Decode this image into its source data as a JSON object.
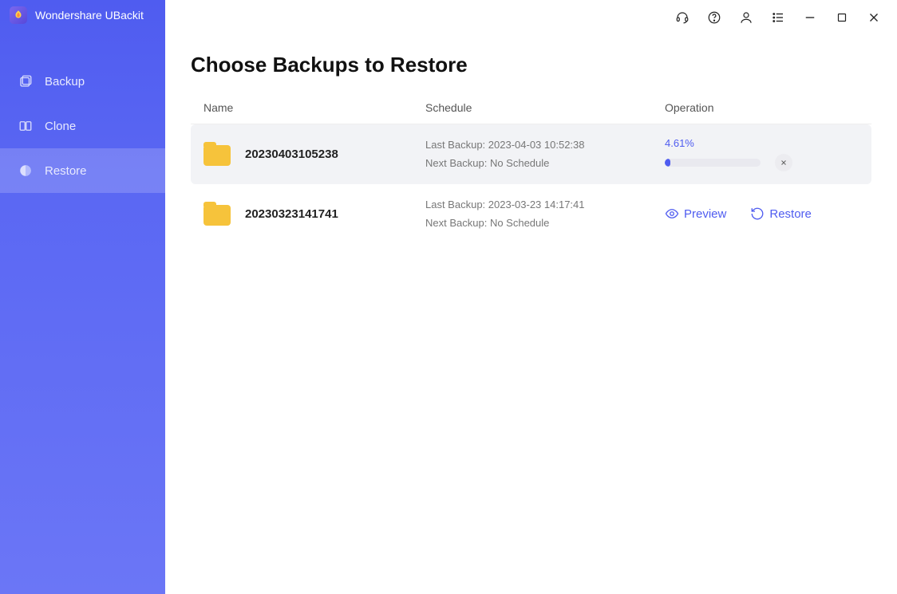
{
  "app": {
    "title": "Wondershare UBackit"
  },
  "sidebar": {
    "items": [
      {
        "label": "Backup"
      },
      {
        "label": "Clone"
      },
      {
        "label": "Restore"
      }
    ],
    "activeIndex": 2
  },
  "page": {
    "title": "Choose Backups to Restore",
    "columns": {
      "name": "Name",
      "schedule": "Schedule",
      "operation": "Operation"
    }
  },
  "rows": [
    {
      "name": "20230403105238",
      "lastLabel": "Last Backup: ",
      "lastValue": "2023-04-03 10:52:38",
      "nextLabel": "Next Backup: ",
      "nextValue": "No Schedule",
      "progress": {
        "text": "4.61%",
        "value": 4.61
      }
    },
    {
      "name": "20230323141741",
      "lastLabel": "Last Backup: ",
      "lastValue": "2023-03-23 14:17:41",
      "nextLabel": "Next Backup: ",
      "nextValue": "No Schedule",
      "actions": {
        "preview": "Preview",
        "restore": "Restore"
      }
    }
  ]
}
